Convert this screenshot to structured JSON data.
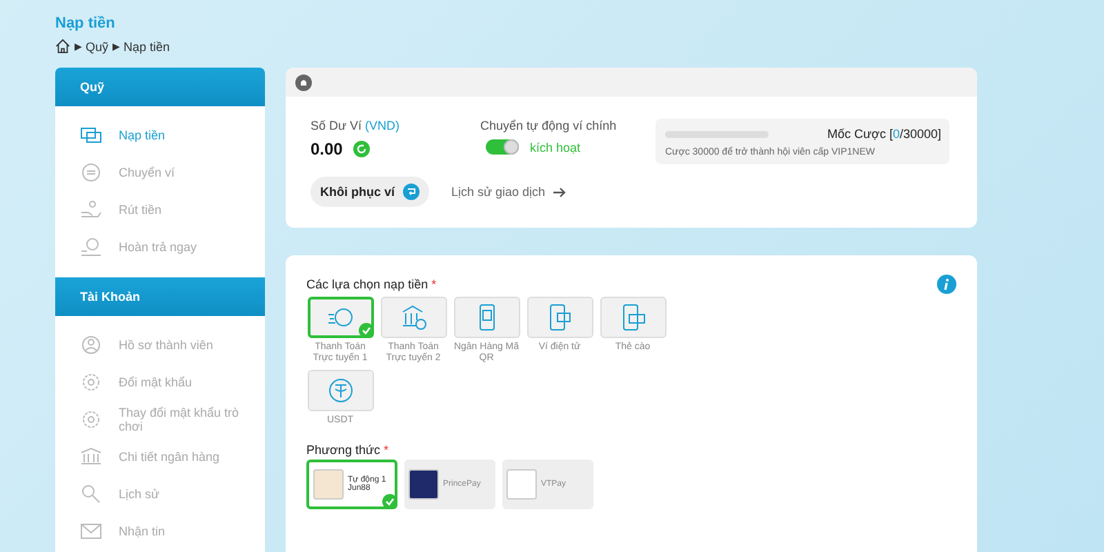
{
  "page_title": "Nạp tiền",
  "breadcrumb": [
    "Quỹ",
    "Nạp tiền"
  ],
  "breadcrumb_sep": "▶",
  "sidebar": [
    {
      "title": "Quỹ",
      "items": [
        {
          "label": "Nạp tiền",
          "selected": true
        },
        {
          "label": "Chuyển ví",
          "selected": false
        },
        {
          "label": "Rút tiền",
          "selected": false
        },
        {
          "label": "Hoàn trả ngay",
          "selected": false
        }
      ]
    },
    {
      "title": "Tài Khoản",
      "items": [
        {
          "label": "Hồ sơ thành viên",
          "selected": false
        },
        {
          "label": "Đổi mật khẩu",
          "selected": false
        },
        {
          "label": "Thay đổi mật khẩu trò chơi",
          "selected": false
        },
        {
          "label": "Chi tiết ngân hàng",
          "selected": false
        },
        {
          "label": "Lịch sử",
          "selected": false
        },
        {
          "label": "Nhận tin",
          "selected": false
        }
      ]
    }
  ],
  "wallet": {
    "balance_label": "Số Dư Ví",
    "balance_unit": "(VND)",
    "balance": "0.00",
    "auto_transfer_label": "Chuyển tự động ví chính",
    "auto_transfer_on": true,
    "auto_transfer_state": "kích hoạt",
    "milestone": {
      "level": 0,
      "prefix": "Mốc Cược [",
      "current": "0",
      "suffix": "/30000]",
      "note": "Cược 30000 để trở thành hội viên cấp VIP1NEW"
    },
    "restore_button": "Khôi phục ví",
    "history_link": "Lịch sử giao dịch"
  },
  "deposit": {
    "options_label": "Các lựa chọn nạp tiền",
    "required_mark": "*",
    "options": [
      {
        "label": "Thanh Toán Trực tuyến 1",
        "selected": true
      },
      {
        "label": "Thanh Toán Trực tuyến 2",
        "selected": false
      },
      {
        "label": "Ngân Hàng Mã QR",
        "selected": false
      },
      {
        "label": "Ví điện tử",
        "selected": false
      },
      {
        "label": "Thẻ cào",
        "selected": false
      },
      {
        "label": "USDT",
        "selected": false
      }
    ],
    "methods_label": "Phương thức",
    "methods_mark": "*",
    "methods": [
      {
        "lines": [
          "Tự động 1",
          "Jun88"
        ],
        "selected": true
      },
      {
        "lines": [
          "PrincePay"
        ],
        "selected": false
      },
      {
        "lines": [
          "VTPay"
        ],
        "selected": false
      }
    ]
  }
}
